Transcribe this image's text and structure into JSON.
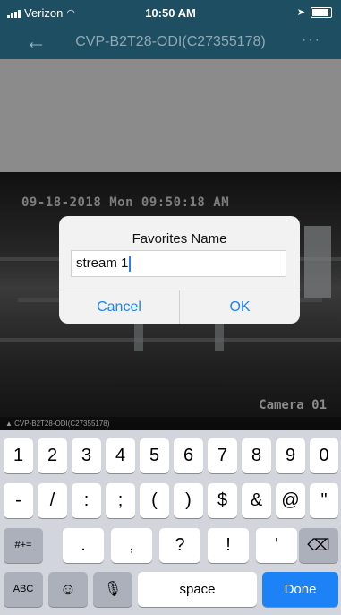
{
  "status": {
    "carrier": "Verizon",
    "time": "10:50 AM"
  },
  "nav": {
    "back_glyph": "←",
    "title": "CVP-B2T28-ODI(C27355178)",
    "more_glyph": "···"
  },
  "video": {
    "timestamp": "09-18-2018 Mon 09:50:18 AM",
    "camera": "Camera 01",
    "channel": "CVP-B2T28-ODI(C27355178)"
  },
  "dialog": {
    "title": "Favorites Name",
    "input_value": "stream 1",
    "cancel_label": "Cancel",
    "ok_label": "OK"
  },
  "keyboard": {
    "row1": [
      "1",
      "2",
      "3",
      "4",
      "5",
      "6",
      "7",
      "8",
      "9",
      "0"
    ],
    "row2": [
      "-",
      "/",
      ":",
      ";",
      "(",
      ")",
      "$",
      "&",
      "@",
      "\""
    ],
    "row3": {
      "mode": "#+=",
      "keys": [
        ".",
        ",",
        "?",
        "!",
        "'"
      ],
      "delete_glyph": "⌫"
    },
    "row4": {
      "abc": "ABC",
      "emoji_glyph": "☺",
      "mic_glyph": "🎙",
      "space": "space",
      "done": "Done"
    }
  },
  "colors": {
    "nav_bg": "#1d4e62",
    "accent": "#1c82f6"
  }
}
